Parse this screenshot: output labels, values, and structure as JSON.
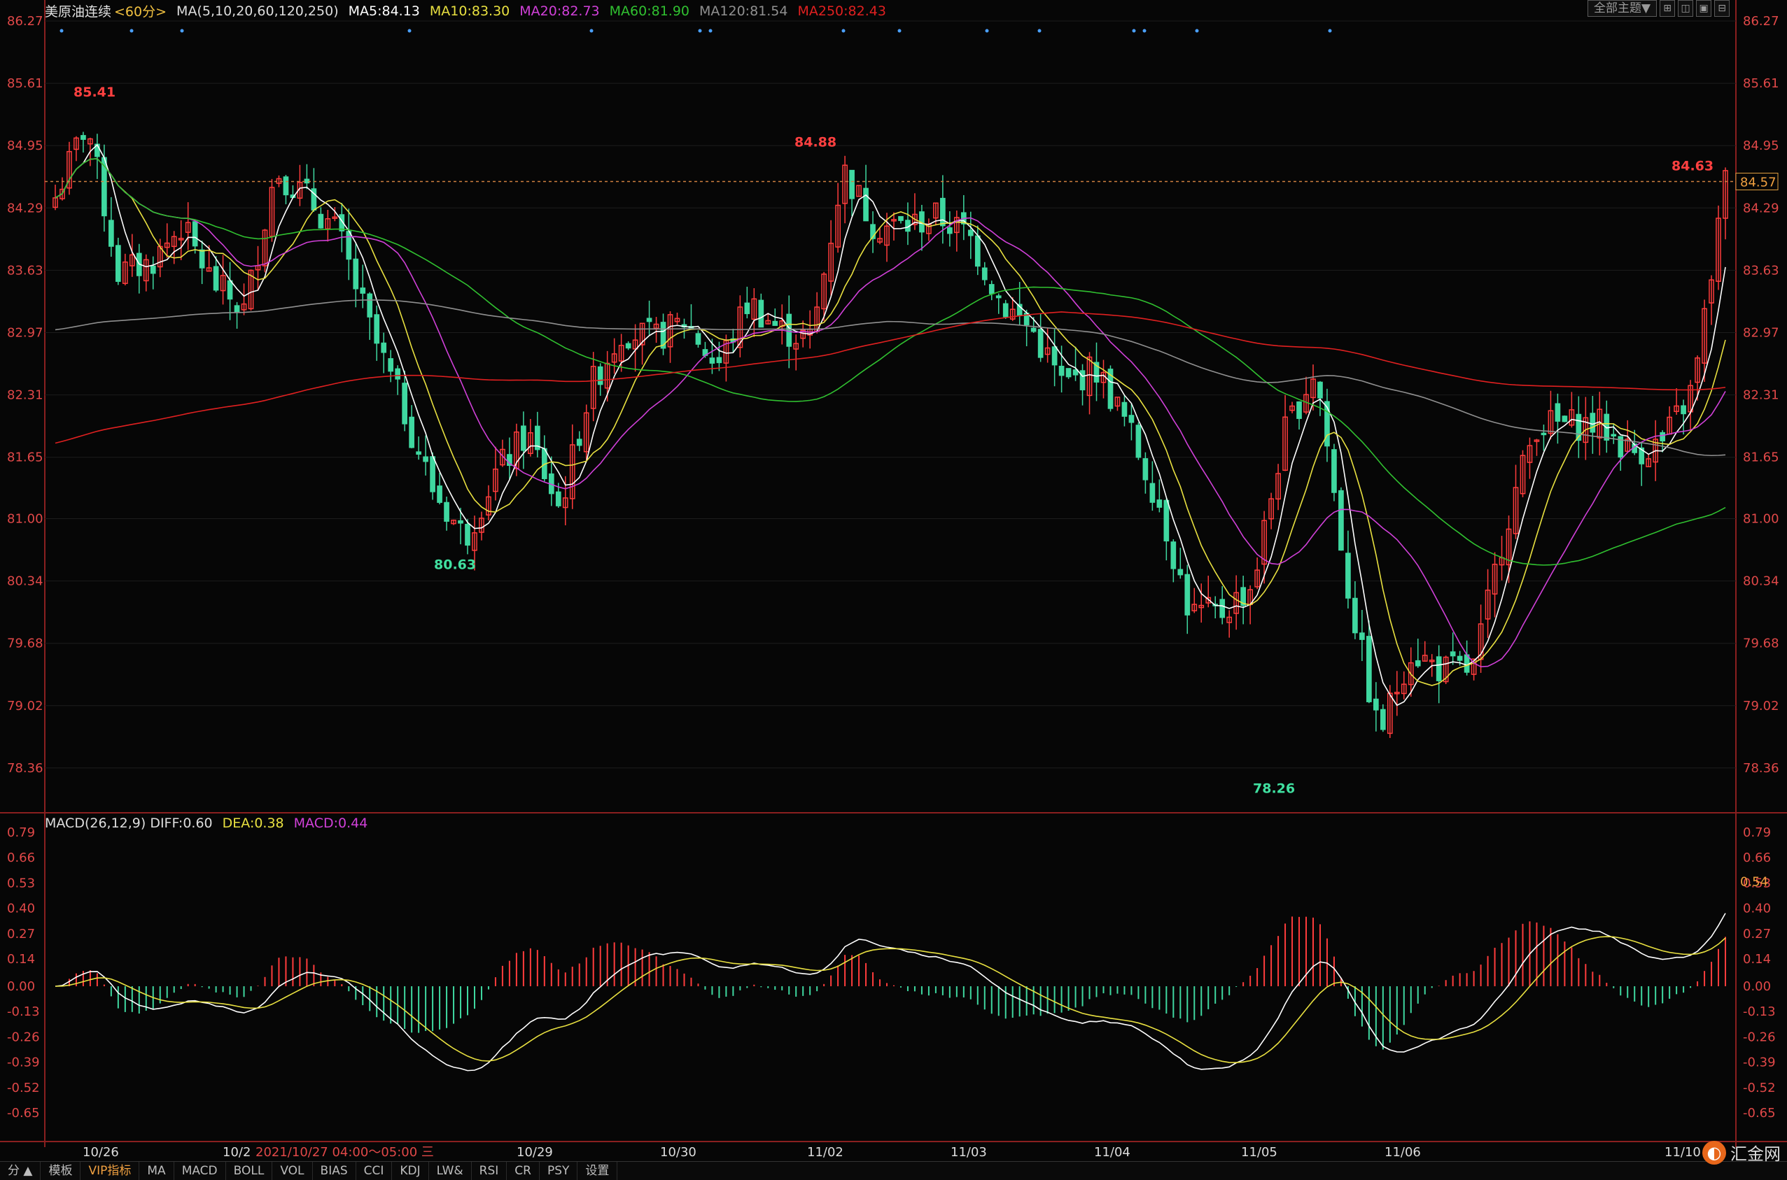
{
  "header": {
    "symbol": "美原油连续",
    "period": "<60分>",
    "ma_label": "MA(5,10,20,60,120,250)",
    "ma5": "MA5:84.13",
    "ma10": "MA10:83.30",
    "ma20": "MA20:82.73",
    "ma60": "MA60:81.90",
    "ma120": "MA120:81.54",
    "ma250": "MA250:82.43"
  },
  "top_controls": {
    "theme_select": "全部主题▼",
    "btn1": "⊞",
    "btn2": "◫",
    "btn3": "▣",
    "btn4": "⊟"
  },
  "macd_header": {
    "label": "MACD(26,12,9)",
    "diff": "DIFF:0.60",
    "dea": "DEA:0.38",
    "macd": "MACD:0.44"
  },
  "colors": {
    "up": "#ff3c3c",
    "down": "#3fd8a0",
    "ma5": "#ffffff",
    "ma10": "#e8e040",
    "ma20": "#d040d8",
    "ma60": "#30c030",
    "ma120": "#909090",
    "ma250": "#e02020",
    "grid": "#1c1c1c",
    "axis": "#e04848"
  },
  "chart_data": {
    "type": "candlestick",
    "price_axis": {
      "ticks": [
        "86.27",
        "85.61",
        "84.95",
        "84.29",
        "83.63",
        "82.97",
        "82.31",
        "81.65",
        "81.00",
        "80.34",
        "79.68",
        "79.02",
        "78.36"
      ],
      "range": [
        77.9,
        86.27
      ]
    },
    "macd_axis": {
      "ticks": [
        "0.79",
        "0.66",
        "0.53",
        "0.40",
        "0.27",
        "0.14",
        "0.00",
        "-0.13",
        "-0.26",
        "-0.39",
        "-0.52",
        "-0.65"
      ],
      "range": [
        -0.79,
        0.79
      ]
    },
    "x_labels": [
      "10/26",
      "10/2",
      "10/29",
      "10/30",
      "11/02",
      "11/03",
      "11/04",
      "11/05",
      "11/06",
      "11/10"
    ],
    "crosshair_time": "2021/10/27 04:00～05:00 三",
    "current_price": "84.57",
    "current_macd": "0.54",
    "annotations": [
      {
        "label": "85.41",
        "value": 85.41,
        "kind": "high"
      },
      {
        "label": "80.63",
        "value": 80.63,
        "kind": "low"
      },
      {
        "label": "84.88",
        "value": 84.88,
        "kind": "high"
      },
      {
        "label": "78.26",
        "value": 78.26,
        "kind": "low"
      },
      {
        "label": "84.63",
        "value": 84.63,
        "kind": "high"
      }
    ],
    "close_anchors": [
      84.4,
      85.2,
      83.6,
      83.7,
      84.1,
      83.5,
      83.2,
      84.7,
      84.4,
      84.0,
      83.0,
      82.2,
      81.3,
      80.8,
      81.5,
      81.9,
      81.1,
      82.4,
      83.0,
      82.9,
      83.1,
      82.6,
      83.3,
      83.0,
      82.9,
      84.7,
      84.1,
      84.1,
      84.2,
      84.0,
      83.3,
      83.0,
      82.4,
      82.6,
      82.0,
      81.2,
      80.0,
      80.0,
      80.3,
      81.9,
      82.6,
      80.3,
      78.7,
      79.6,
      79.4,
      79.4,
      80.9,
      82.0,
      82.0,
      82.0,
      81.7,
      81.8,
      82.4,
      84.57
    ],
    "volume_series": "macd"
  },
  "tabs": [
    "分 ▲",
    "模板",
    "VIP指标",
    "MA",
    "MACD",
    "BOLL",
    "VOL",
    "BIAS",
    "CCI",
    "KDJ",
    "LW&",
    "RSI",
    "CR",
    "PSY",
    "设置"
  ],
  "logo": {
    "text": "汇金网"
  }
}
